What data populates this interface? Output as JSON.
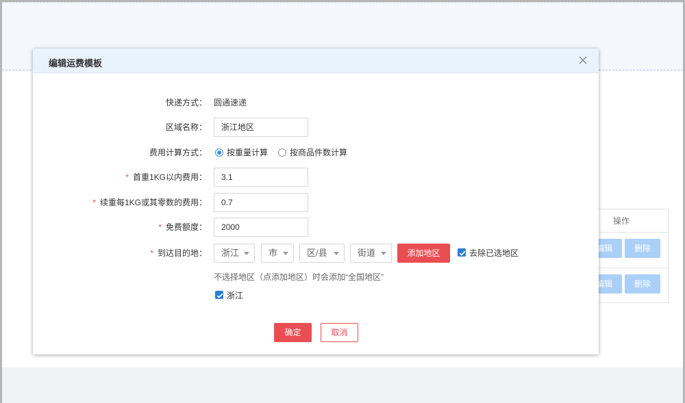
{
  "modal": {
    "title": "编辑运费模板",
    "fields": {
      "shipping_method": {
        "label": "快递方式：",
        "value": "圆通速递"
      },
      "region_name": {
        "label": "区域名称：",
        "value": "浙江地区"
      },
      "fee_calc": {
        "label": "费用计算方式：",
        "options": [
          "按重量计算",
          "按商品件数计算"
        ],
        "selected": "按重量计算"
      },
      "first_weight_fee": {
        "required_mark": "*",
        "label": "首重1KG以内费用：",
        "value": "3.1"
      },
      "additional_fee": {
        "required_mark": "*",
        "label": "续重每1KG或其零数的费用：",
        "value": "0.7"
      },
      "free_quota": {
        "required_mark": "*",
        "label": "免费额度：",
        "value": "2000"
      },
      "destination": {
        "required_mark": "*",
        "label": "到达目的地：",
        "province": "浙江",
        "city": "市",
        "district": "区/县",
        "street": "街道",
        "add_button": "添加地区",
        "remove_selected_label": "去除已选地区",
        "remove_selected_checked": true
      },
      "hint": "不选择地区（点添加地区）时会添加“全国地区”",
      "selected_region": {
        "label": "浙江",
        "checked": true
      }
    },
    "confirm_button": "确定",
    "cancel_button": "取消"
  },
  "background_table": {
    "header": "操作",
    "rows": [
      {
        "edit": "编辑",
        "delete": "删除"
      },
      {
        "edit": "编辑",
        "delete": "删除"
      }
    ]
  },
  "colors": {
    "primary_red": "#e94e52",
    "header_blue": "#e9f3fd",
    "accent_blue": "#3b8fe6",
    "disabled_blue": "#abd0f7"
  }
}
